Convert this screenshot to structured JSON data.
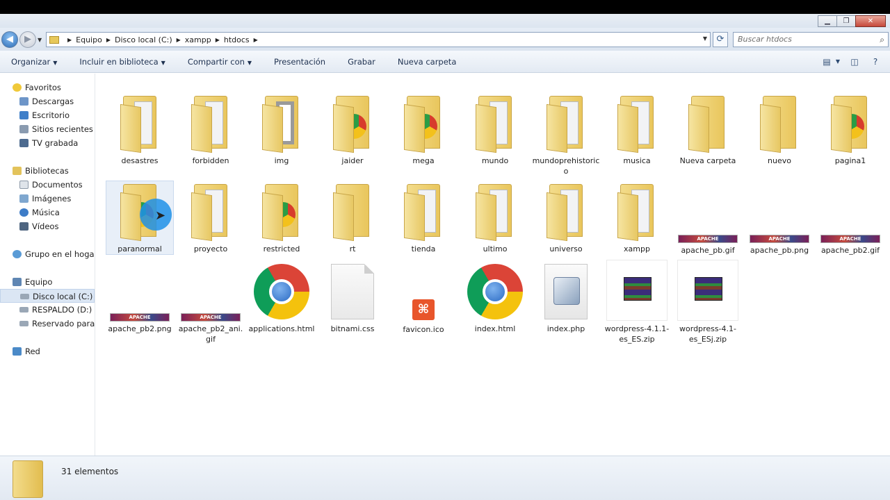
{
  "window": {
    "controls": [
      "▁",
      "❐",
      "✕"
    ]
  },
  "address": {
    "crumbs": [
      "Equipo",
      "Disco local (C:)",
      "xampp",
      "htdocs"
    ],
    "search_placeholder": "Buscar htdocs"
  },
  "toolbar": {
    "organize": "Organizar",
    "include": "Incluir en biblioteca",
    "share": "Compartir con",
    "slideshow": "Presentación",
    "burn": "Grabar",
    "new_folder": "Nueva carpeta"
  },
  "sidebar": {
    "favorites": "Favoritos",
    "fav_items": [
      "Descargas",
      "Escritorio",
      "Sitios recientes",
      "TV grabada"
    ],
    "libraries": "Bibliotecas",
    "lib_items": [
      "Documentos",
      "Imágenes",
      "Música",
      "Vídeos"
    ],
    "homegroup": "Grupo en el hogar",
    "computer": "Equipo",
    "computer_items": [
      "Disco local (C:)",
      "RESPALDO (D:)",
      "Reservado para el"
    ],
    "network": "Red"
  },
  "items": {
    "row1": [
      "desastres",
      "forbidden",
      "img",
      "jaider",
      "mega",
      "mundo",
      "mundoprehistorico",
      "musica",
      "Nueva carpeta",
      "nuevo",
      "pagina1"
    ],
    "row2": [
      "paranormal",
      "proyecto",
      "restricted",
      "rt",
      "tienda",
      "ultimo",
      "universo",
      "xampp",
      "apache_pb.gif",
      "apache_pb.png",
      "apache_pb2.gif"
    ],
    "row3": [
      "apache_pb2.png",
      "apache_pb2_ani.gif",
      "applications.html",
      "bitnami.css",
      "favicon.ico",
      "index.html",
      "index.php",
      "wordpress-4.1.1-es_ES.zip",
      "wordpress-4.1-es_ESj.zip"
    ]
  },
  "status": {
    "count": "31 elementos"
  },
  "icon_text": {
    "apache": "APACHE",
    "xampp": "⌘"
  },
  "colors": {
    "selection": "#dbe6f4",
    "folder": "#e9c65c"
  }
}
